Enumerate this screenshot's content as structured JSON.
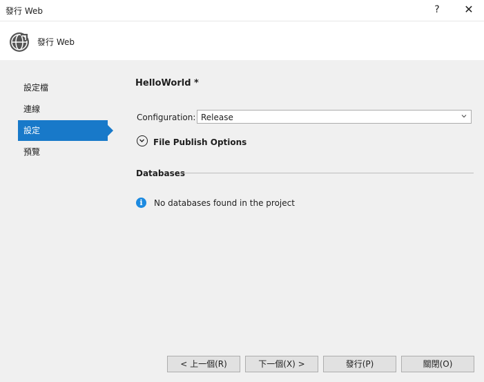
{
  "window": {
    "title": "發行 Web",
    "help_glyph": "?",
    "close_glyph": "✕"
  },
  "header": {
    "title": "發行 Web",
    "icon": "globe-publish-icon"
  },
  "nav": {
    "items": [
      {
        "label": "設定檔"
      },
      {
        "label": "連線"
      },
      {
        "label": "設定"
      },
      {
        "label": "預覽"
      }
    ],
    "active": "設定"
  },
  "main": {
    "profile_name": "HelloWorld *",
    "configuration": {
      "label": "Configuration:",
      "value": "Release"
    },
    "file_publish_options": "File Publish Options",
    "databases": {
      "heading": "Databases",
      "message": "No databases found in the project"
    }
  },
  "buttons": {
    "prev": "< 上一個(R)",
    "next": "下一個(X) >",
    "publish": "發行(P)",
    "close": "關閉(O)"
  },
  "colors": {
    "accent": "#1879c9",
    "info": "#1c8ae0"
  }
}
